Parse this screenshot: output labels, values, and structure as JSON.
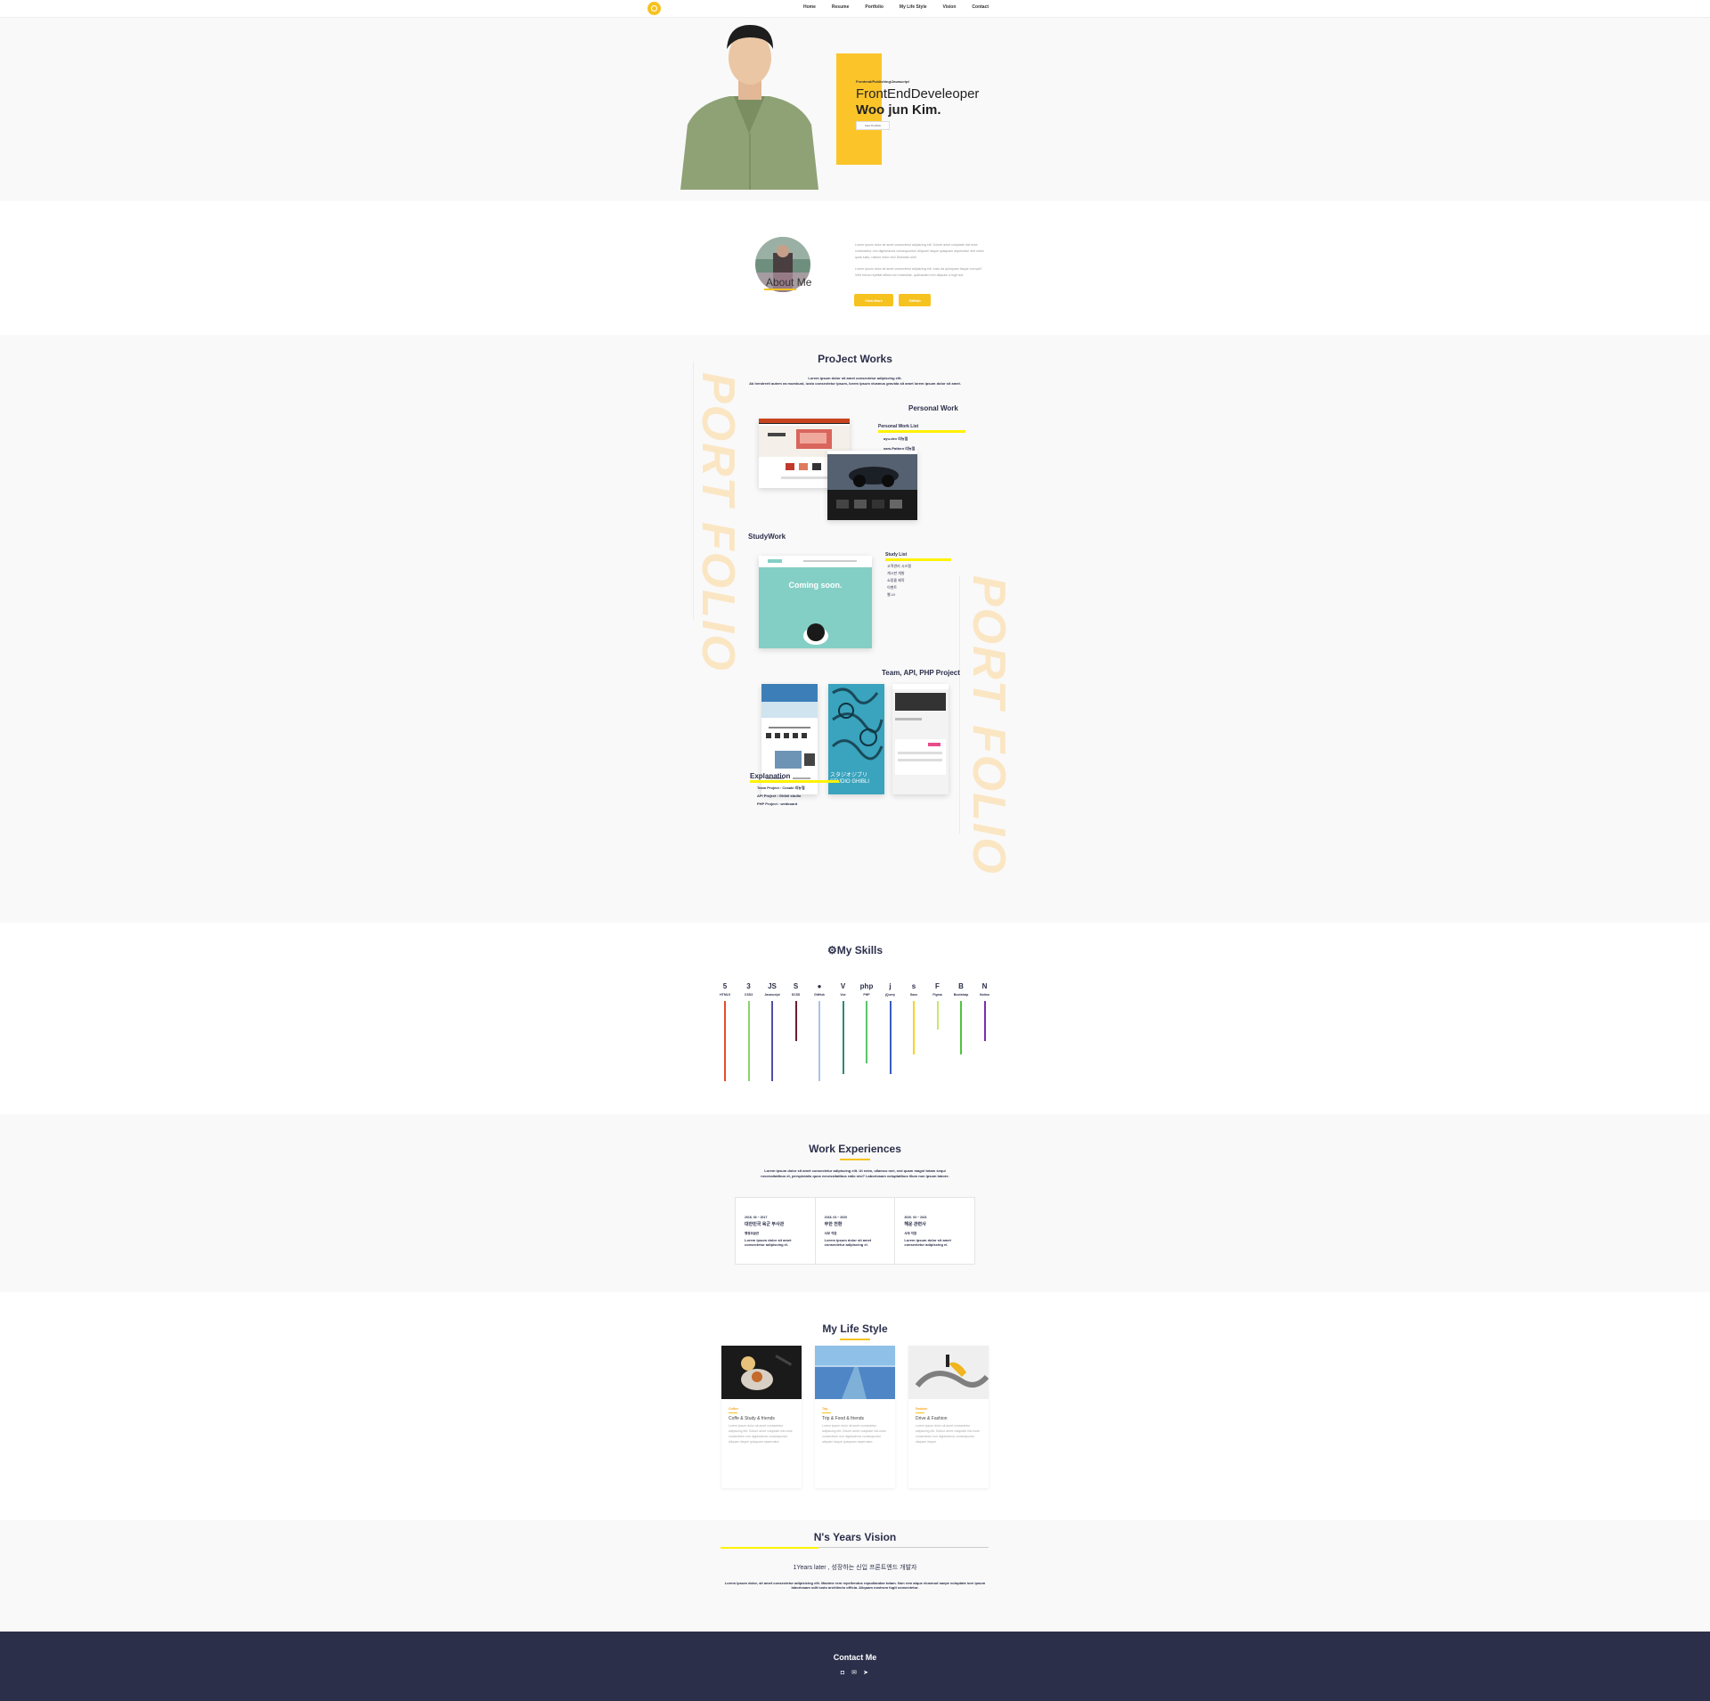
{
  "nav": {
    "items": [
      "Home",
      "Resume",
      "Portfolio",
      "My Life Style",
      "Vision",
      "Contact"
    ]
  },
  "hero": {
    "tag": "Frontend/Publishing/Javascript",
    "title": "FrontEndDeveleoper",
    "name": "Woo jun Kim.",
    "button": "View Portfolio"
  },
  "about": {
    "title": "About Me",
    "text1": "Lorem ipsum dolor sit amet consectetur adipiscing elit. Dolore amet voluptate nisi esse consectetur non dignissimos consequuntur! Aliquam itaque quisquam aspernatur sint nobis quas iusto, ratione dolor nisi! Distinctio sint!",
    "text2": "Lorem ipsum dolor sit amet consectetur adipiscing elit. Iusto ad quisquam itaque corrupti? Velit minus repellat officia non molestiae, quibusdam rem aliquam a fugit aut.",
    "buttons": [
      "View More",
      "GitHub"
    ]
  },
  "projects": {
    "title": "ProJect Works",
    "sub1": "Lorem ipsum dolor sit amet consectetur adipiscing elit.",
    "sub2": "Ab hendrerit autem ea mumbust, iusto consectetur ipsum, lorem ipsum vivamus gravida sit amet lorem ipsum dolor sit amet.",
    "vertical_text": "PORT FOLIO",
    "personal_heading": "Personal Work",
    "personal_list_heading": "Personal Work List",
    "personal_items": [
      "ayu-dev 리뉴얼",
      "sam-Pattern 리뉴얼"
    ],
    "study_heading": "StudyWork",
    "study_list_heading": "Study List",
    "study_items": [
      "고객관리 시스템",
      "게시판 개발",
      "쇼핑몰 제작",
      "이벤트",
      "웹 UI"
    ],
    "team_heading": "Team, API, PHP Project",
    "explanation_heading": "Explanation",
    "explanation_items": [
      "Team Project : Cosaki 리뉴얼",
      "API Project : Ghibli studio",
      "PHP Project : webboard"
    ],
    "coming_soon": "Coming soon.",
    "ghibli_text": "スタジオジブリ STUDIO GHIBLI"
  },
  "skills": {
    "title": "My Skills",
    "items": [
      {
        "name": "HTML5",
        "icon": "5",
        "color": "#e44d26",
        "length": 90
      },
      {
        "name": "CSS3",
        "icon": "3",
        "color": "#8bd46a",
        "length": 90
      },
      {
        "name": "Javascript",
        "icon": "JS",
        "color": "#4f4fa8",
        "length": 90
      },
      {
        "name": "SCSS",
        "icon": "S",
        "color": "#6b1c2a",
        "length": 45
      },
      {
        "name": "GitHub",
        "icon": "●",
        "color": "#a9c4e8",
        "length": 90
      },
      {
        "name": "Vue",
        "icon": "V",
        "color": "#2c8a77",
        "length": 82
      },
      {
        "name": "PHP",
        "icon": "php",
        "color": "#5ac46b",
        "length": 70
      },
      {
        "name": "jQuery",
        "icon": "j",
        "color": "#3a5bbf",
        "length": 82
      },
      {
        "name": "Sass",
        "icon": "s",
        "color": "#f6d61f",
        "length": 60
      },
      {
        "name": "Figma",
        "icon": "F",
        "color": "#c5e86b",
        "length": 32
      },
      {
        "name": "Bootstrap",
        "icon": "B",
        "color": "#4ec43c",
        "length": 60
      },
      {
        "name": "Notion",
        "icon": "N",
        "color": "#7a2fb0",
        "length": 45
      }
    ]
  },
  "work": {
    "title": "Work Experiences",
    "desc1": "Lorem ipsum dolor sit amet consectetur adipiscing elit. Ut enim, ullamco mei, sed quam magni totam sequi",
    "desc2": "necessitatibus et, perspiciatis quos necessitatibus ratio nisi? Laboriosam voluptatibus illum non ipsum labore.",
    "cards": [
      {
        "date": "2016. 03 ~ 2017",
        "company": "대한민국 육군 부사관",
        "role": "행정보급관",
        "desc": "Lorem ipsum dolor sit amet consectetur adipiscing el."
      },
      {
        "date": "2018. 03 ~ 2020",
        "company": "무한 전환",
        "role": "사무 직원",
        "desc": "Lorem ipsum dolor sit amet consectetur adipiscing el."
      },
      {
        "date": "2020. 03 ~ 2021",
        "company": "해운 관련사",
        "role": "사무 직원",
        "desc": "Lorem ipsum dolor sit amet consectetur adipiscing el."
      }
    ]
  },
  "life": {
    "title": "My Life Style",
    "cards": [
      {
        "category": "Coffee",
        "title": "Coffe & Study & friends",
        "text": "Lorem ipsum dolor sit amet consectetur adipiscing elit. Dolore amet voluptate nisi esse consectetur non dignissimos consequuntur aliquam itaque quisquam aspernatur."
      },
      {
        "category": "Trip",
        "title": "Trip & Food & friends",
        "text": "Lorem ipsum dolor sit amet consectetur adipiscing elit. Dolore amet voluptate nisi esse consectetur non dignissimos consequuntur aliquam itaque quisquam aspernatur."
      },
      {
        "category": "Fashion",
        "title": "Drive & Fashion",
        "text": "Lorem ipsum dolor sit amet consectetur adipiscing elit. Dolore amet voluptate nisi esse consectetur non dignissimos consequuntur aliquam itaque."
      }
    ]
  },
  "vision": {
    "title": "N's Years Vision",
    "line1": "1Years later , 성장하는 신입 프론트엔드 개발자",
    "line2": "Lorem ipsum dolor, sit amet consectetur adipisicing elit. Maxime rem repellendus repudiandae totam. Non rem atque eiusmod saepe voluptate iure ipsum laboriosam odit iusto architecto officia. Aliquam nostrum fugit consectetur."
  },
  "footer": {
    "title": "Contact Me"
  },
  "colors": {
    "accent": "#f6c21f",
    "navy": "#2b2f4a",
    "highlight": "#fff200"
  }
}
